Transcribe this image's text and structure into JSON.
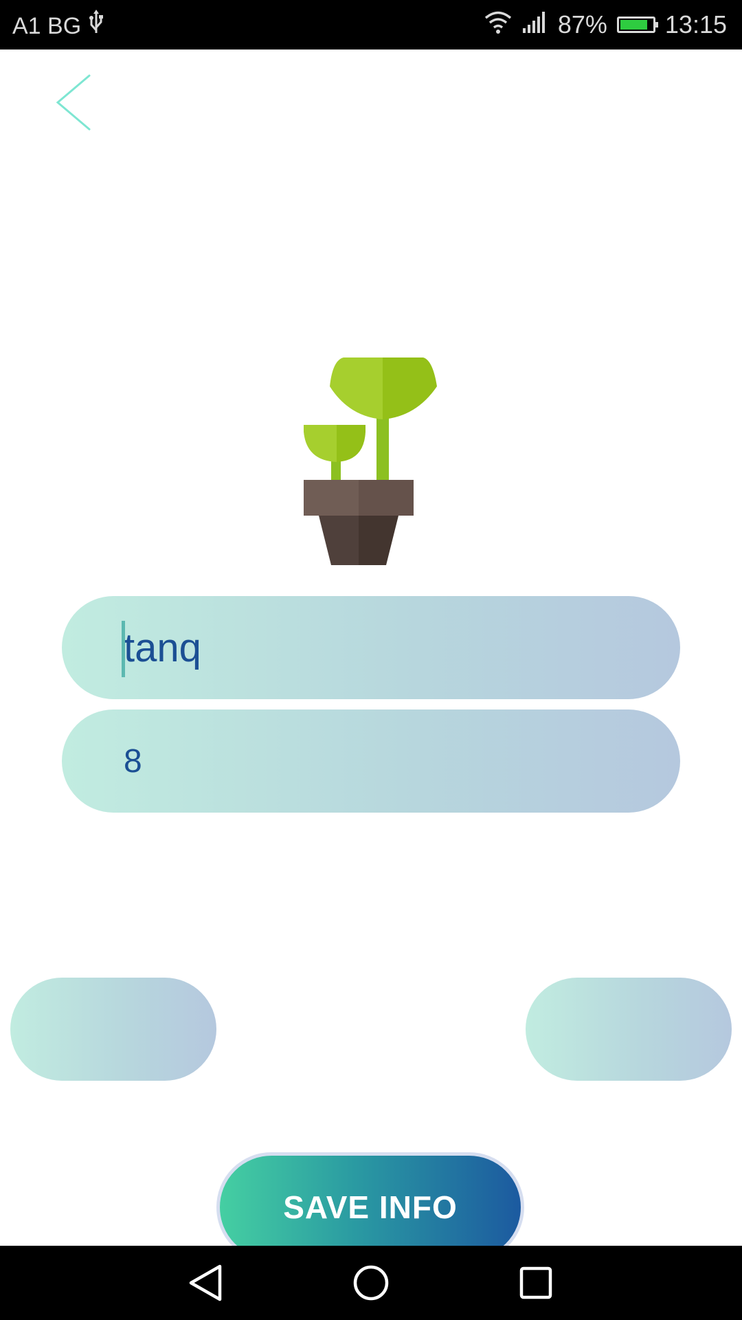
{
  "status_bar": {
    "carrier": "A1 BG",
    "usb_icon": "usb-icon",
    "wifi_icon": "wifi-icon",
    "signal_icon": "signal-icon",
    "battery_percent": "87%",
    "battery_level": 0.87,
    "battery_color": "#2ecc40",
    "time": "13:15"
  },
  "header": {
    "back_icon": "chevron-left-icon",
    "back_color": "#7ee6d2"
  },
  "illustration": {
    "icon": "potted-plant-icon"
  },
  "form": {
    "name_value": "tanq",
    "age_value": "8"
  },
  "actions": {
    "left_pill_label": "",
    "right_pill_label": "",
    "save_label": "SAVE INFO"
  },
  "colors": {
    "input_gradient_start": "#c1ece0",
    "input_gradient_end": "#b5c8de",
    "input_text": "#1b4f94",
    "save_gradient_start": "#45cfa2",
    "save_gradient_end": "#1c5aa0"
  },
  "nav_bar": {
    "back_icon": "nav-back-icon",
    "home_icon": "nav-home-icon",
    "recents_icon": "nav-recents-icon"
  }
}
